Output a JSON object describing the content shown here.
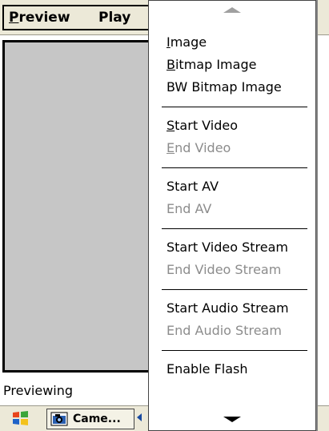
{
  "menubar": {
    "preview_label": "Preview",
    "playback_label": "Play"
  },
  "status": {
    "text": "Previewing"
  },
  "taskbar": {
    "task_label": "Came..."
  },
  "menu": {
    "items": [
      {
        "label": "Image",
        "underline": "I",
        "enabled": true
      },
      {
        "label": "Bitmap Image",
        "underline": "B",
        "enabled": true
      },
      {
        "label": "BW Bitmap Image",
        "underline": "",
        "enabled": true
      },
      {
        "label": "Start Video",
        "underline": "S",
        "enabled": true
      },
      {
        "label": "End Video",
        "underline": "E",
        "enabled": false
      },
      {
        "label": "Start AV",
        "underline": "",
        "enabled": true
      },
      {
        "label": "End AV",
        "underline": "",
        "enabled": false
      },
      {
        "label": "Start Video Stream",
        "underline": "",
        "enabled": true
      },
      {
        "label": "End Video Stream",
        "underline": "",
        "enabled": false
      },
      {
        "label": "Start Audio Stream",
        "underline": "",
        "enabled": true
      },
      {
        "label": "End Audio Stream",
        "underline": "",
        "enabled": false
      },
      {
        "label": "Enable Flash",
        "underline": "",
        "enabled": true
      }
    ]
  },
  "colors": {
    "menu_bg": "#ffffff",
    "disabled_text": "#8c8c8c",
    "preview_pane": "#c6c6c6",
    "chrome": "#ece9d8"
  }
}
